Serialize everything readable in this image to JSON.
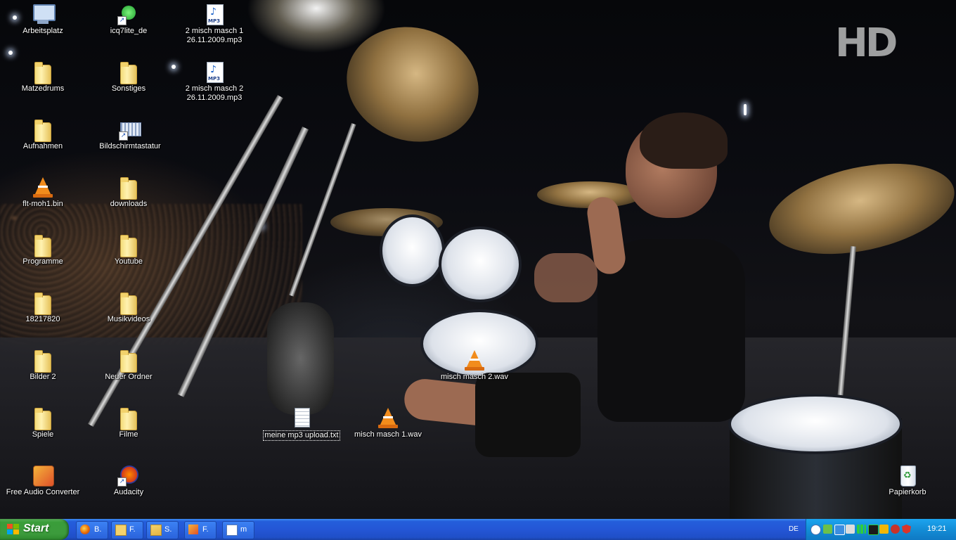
{
  "desktop": {
    "icons": [
      {
        "label": "Arbeitsplatz",
        "type": "computer"
      },
      {
        "label": "icq7lite_de",
        "type": "icq-shortcut"
      },
      {
        "label": "2 misch masch 1\n26.11.2009.mp3",
        "type": "mp3"
      },
      {
        "label": "Matzedrums",
        "type": "folder"
      },
      {
        "label": "Sonstiges",
        "type": "folder"
      },
      {
        "label": "2 misch masch 2\n26.11.2009.mp3",
        "type": "mp3"
      },
      {
        "label": "Aufnahmen",
        "type": "folder"
      },
      {
        "label": "Bildschirmtastatur",
        "type": "keyboard-shortcut"
      },
      {
        "label": "flt-moh1.bin",
        "type": "vlc-file"
      },
      {
        "label": "downloads",
        "type": "folder"
      },
      {
        "label": "Programme",
        "type": "folder"
      },
      {
        "label": "Youtube",
        "type": "folder"
      },
      {
        "label": "18217820",
        "type": "folder"
      },
      {
        "label": "Musikvideos",
        "type": "folder"
      },
      {
        "label": "Bilder 2",
        "type": "folder"
      },
      {
        "label": "Neuer Ordner",
        "type": "folder"
      },
      {
        "label": "misch masch 2.wav",
        "type": "vlc-file"
      },
      {
        "label": "Spiele",
        "type": "folder"
      },
      {
        "label": "Filme",
        "type": "folder"
      },
      {
        "label": "meine mp3 upload.txt",
        "type": "text-file"
      },
      {
        "label": "misch masch 1.wav",
        "type": "vlc-file"
      },
      {
        "label": "Free Audio Converter",
        "type": "app-shortcut"
      },
      {
        "label": "Audacity",
        "type": "app-shortcut"
      },
      {
        "label": "Papierkorb",
        "type": "recycle-bin"
      }
    ],
    "wallpaper_logo": "HD"
  },
  "taskbar": {
    "start_label": "Start",
    "buttons": [
      {
        "label": "B.",
        "icon": "firefox-icon"
      },
      {
        "label": "F.",
        "icon": "folder-icon"
      },
      {
        "label": "S.",
        "icon": "folder-open-icon"
      },
      {
        "label": "F.",
        "icon": "free-audio-converter-icon"
      },
      {
        "label": "m",
        "icon": "notepad-icon"
      }
    ],
    "language": "DE",
    "clock": "19:21",
    "colors": {
      "bar": "#245edb",
      "start": "#3a9d3a",
      "tray": "#138dd6"
    }
  }
}
